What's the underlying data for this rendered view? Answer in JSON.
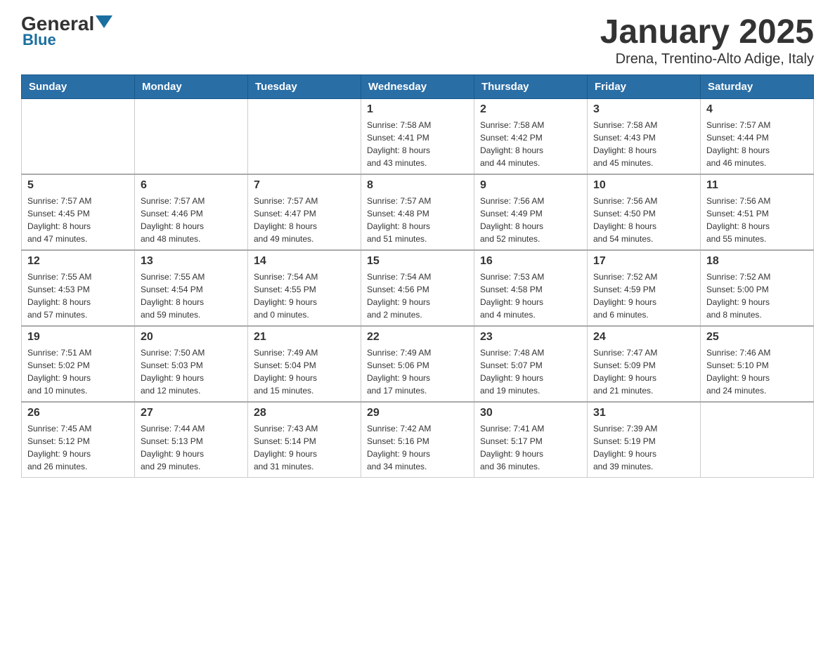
{
  "header": {
    "logo_general": "General",
    "logo_blue": "Blue",
    "month_title": "January 2025",
    "location": "Drena, Trentino-Alto Adige, Italy"
  },
  "weekdays": [
    "Sunday",
    "Monday",
    "Tuesday",
    "Wednesday",
    "Thursday",
    "Friday",
    "Saturday"
  ],
  "weeks": [
    [
      {
        "day": "",
        "info": ""
      },
      {
        "day": "",
        "info": ""
      },
      {
        "day": "",
        "info": ""
      },
      {
        "day": "1",
        "info": "Sunrise: 7:58 AM\nSunset: 4:41 PM\nDaylight: 8 hours\nand 43 minutes."
      },
      {
        "day": "2",
        "info": "Sunrise: 7:58 AM\nSunset: 4:42 PM\nDaylight: 8 hours\nand 44 minutes."
      },
      {
        "day": "3",
        "info": "Sunrise: 7:58 AM\nSunset: 4:43 PM\nDaylight: 8 hours\nand 45 minutes."
      },
      {
        "day": "4",
        "info": "Sunrise: 7:57 AM\nSunset: 4:44 PM\nDaylight: 8 hours\nand 46 minutes."
      }
    ],
    [
      {
        "day": "5",
        "info": "Sunrise: 7:57 AM\nSunset: 4:45 PM\nDaylight: 8 hours\nand 47 minutes."
      },
      {
        "day": "6",
        "info": "Sunrise: 7:57 AM\nSunset: 4:46 PM\nDaylight: 8 hours\nand 48 minutes."
      },
      {
        "day": "7",
        "info": "Sunrise: 7:57 AM\nSunset: 4:47 PM\nDaylight: 8 hours\nand 49 minutes."
      },
      {
        "day": "8",
        "info": "Sunrise: 7:57 AM\nSunset: 4:48 PM\nDaylight: 8 hours\nand 51 minutes."
      },
      {
        "day": "9",
        "info": "Sunrise: 7:56 AM\nSunset: 4:49 PM\nDaylight: 8 hours\nand 52 minutes."
      },
      {
        "day": "10",
        "info": "Sunrise: 7:56 AM\nSunset: 4:50 PM\nDaylight: 8 hours\nand 54 minutes."
      },
      {
        "day": "11",
        "info": "Sunrise: 7:56 AM\nSunset: 4:51 PM\nDaylight: 8 hours\nand 55 minutes."
      }
    ],
    [
      {
        "day": "12",
        "info": "Sunrise: 7:55 AM\nSunset: 4:53 PM\nDaylight: 8 hours\nand 57 minutes."
      },
      {
        "day": "13",
        "info": "Sunrise: 7:55 AM\nSunset: 4:54 PM\nDaylight: 8 hours\nand 59 minutes."
      },
      {
        "day": "14",
        "info": "Sunrise: 7:54 AM\nSunset: 4:55 PM\nDaylight: 9 hours\nand 0 minutes."
      },
      {
        "day": "15",
        "info": "Sunrise: 7:54 AM\nSunset: 4:56 PM\nDaylight: 9 hours\nand 2 minutes."
      },
      {
        "day": "16",
        "info": "Sunrise: 7:53 AM\nSunset: 4:58 PM\nDaylight: 9 hours\nand 4 minutes."
      },
      {
        "day": "17",
        "info": "Sunrise: 7:52 AM\nSunset: 4:59 PM\nDaylight: 9 hours\nand 6 minutes."
      },
      {
        "day": "18",
        "info": "Sunrise: 7:52 AM\nSunset: 5:00 PM\nDaylight: 9 hours\nand 8 minutes."
      }
    ],
    [
      {
        "day": "19",
        "info": "Sunrise: 7:51 AM\nSunset: 5:02 PM\nDaylight: 9 hours\nand 10 minutes."
      },
      {
        "day": "20",
        "info": "Sunrise: 7:50 AM\nSunset: 5:03 PM\nDaylight: 9 hours\nand 12 minutes."
      },
      {
        "day": "21",
        "info": "Sunrise: 7:49 AM\nSunset: 5:04 PM\nDaylight: 9 hours\nand 15 minutes."
      },
      {
        "day": "22",
        "info": "Sunrise: 7:49 AM\nSunset: 5:06 PM\nDaylight: 9 hours\nand 17 minutes."
      },
      {
        "day": "23",
        "info": "Sunrise: 7:48 AM\nSunset: 5:07 PM\nDaylight: 9 hours\nand 19 minutes."
      },
      {
        "day": "24",
        "info": "Sunrise: 7:47 AM\nSunset: 5:09 PM\nDaylight: 9 hours\nand 21 minutes."
      },
      {
        "day": "25",
        "info": "Sunrise: 7:46 AM\nSunset: 5:10 PM\nDaylight: 9 hours\nand 24 minutes."
      }
    ],
    [
      {
        "day": "26",
        "info": "Sunrise: 7:45 AM\nSunset: 5:12 PM\nDaylight: 9 hours\nand 26 minutes."
      },
      {
        "day": "27",
        "info": "Sunrise: 7:44 AM\nSunset: 5:13 PM\nDaylight: 9 hours\nand 29 minutes."
      },
      {
        "day": "28",
        "info": "Sunrise: 7:43 AM\nSunset: 5:14 PM\nDaylight: 9 hours\nand 31 minutes."
      },
      {
        "day": "29",
        "info": "Sunrise: 7:42 AM\nSunset: 5:16 PM\nDaylight: 9 hours\nand 34 minutes."
      },
      {
        "day": "30",
        "info": "Sunrise: 7:41 AM\nSunset: 5:17 PM\nDaylight: 9 hours\nand 36 minutes."
      },
      {
        "day": "31",
        "info": "Sunrise: 7:39 AM\nSunset: 5:19 PM\nDaylight: 9 hours\nand 39 minutes."
      },
      {
        "day": "",
        "info": ""
      }
    ]
  ]
}
